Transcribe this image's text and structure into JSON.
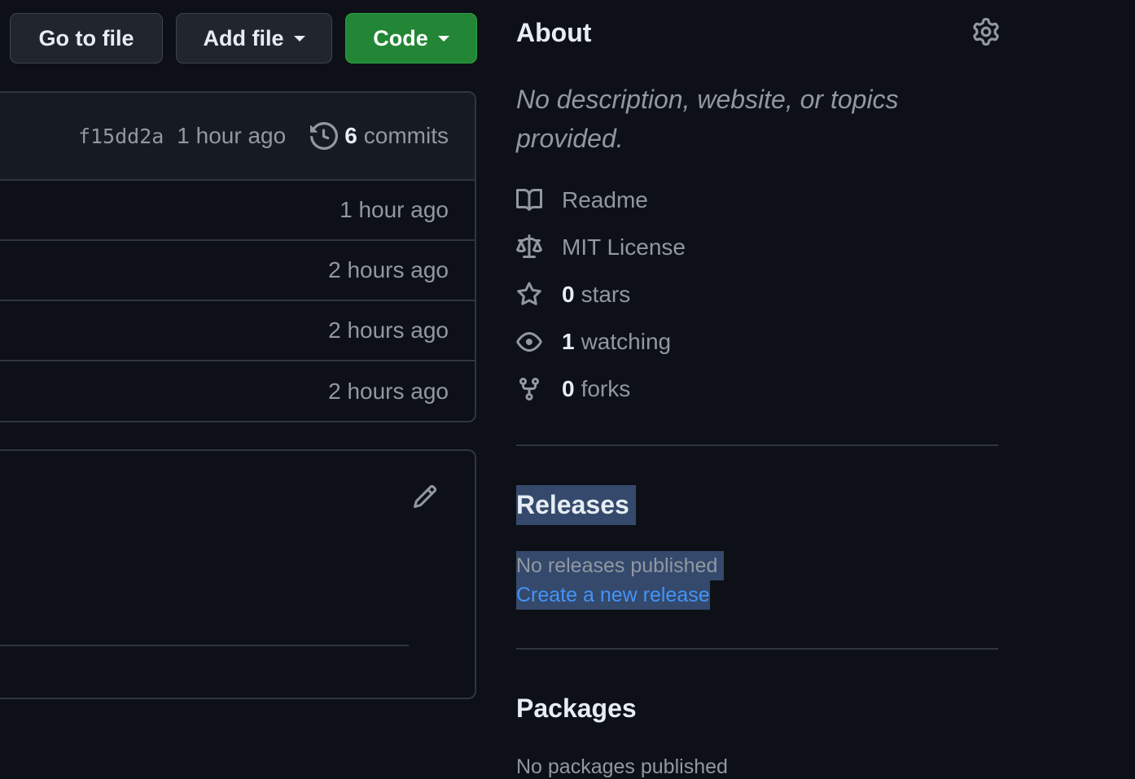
{
  "toolbar": {
    "go_to_file": "Go to file",
    "add_file": "Add file",
    "code": "Code"
  },
  "commit_bar": {
    "sha": "f15dd2a",
    "time": "1 hour ago",
    "commit_count": "6",
    "commit_word": "commits"
  },
  "file_rows": [
    {
      "time": "1 hour ago"
    },
    {
      "time": "2 hours ago"
    },
    {
      "time": "2 hours ago"
    },
    {
      "time": "2 hours ago"
    }
  ],
  "about": {
    "title": "About",
    "description": "No description, website, or topics provided.",
    "readme": "Readme",
    "license": "MIT License",
    "stars_count": "0",
    "stars_label": "stars",
    "watching_count": "1",
    "watching_label": "watching",
    "forks_count": "0",
    "forks_label": "forks"
  },
  "releases": {
    "title": "Releases",
    "none_text": "No releases published",
    "create_link": "Create a new release"
  },
  "packages": {
    "title": "Packages",
    "none_text": "No packages published"
  },
  "colors": {
    "background": "#0d1117",
    "code_button": "#238636",
    "link": "#4493f8",
    "selection": "#34496b"
  }
}
